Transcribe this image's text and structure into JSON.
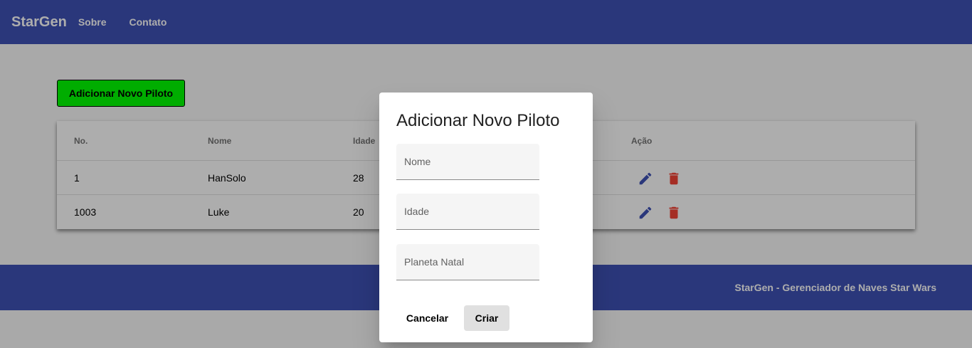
{
  "navbar": {
    "brand": "StarGen",
    "links": [
      "Sobre",
      "Contato"
    ]
  },
  "add_button": {
    "label": "Adicionar Novo Piloto"
  },
  "table": {
    "headers": {
      "no": "No.",
      "nome": "Nome",
      "idade": "Idade",
      "acao": "Ação"
    },
    "rows": [
      {
        "no": "1",
        "nome": "HanSolo",
        "idade": "28"
      },
      {
        "no": "1003",
        "nome": "Luke",
        "idade": "20"
      }
    ]
  },
  "footer": {
    "text": "StarGen - Gerenciador de Naves Star Wars"
  },
  "dialog": {
    "title": "Adicionar Novo Piloto",
    "fields": {
      "nome_placeholder": "Nome",
      "idade_placeholder": "Idade",
      "planeta_placeholder": "Planeta Natal"
    },
    "cancel_label": "Cancelar",
    "create_label": "Criar"
  },
  "colors": {
    "primary": "#3f51b5",
    "add_button": "#00ff00",
    "edit_icon": "#3f51b5",
    "delete_icon": "#f44336"
  },
  "icons": {
    "edit": "pencil-icon",
    "delete": "trash-icon"
  }
}
